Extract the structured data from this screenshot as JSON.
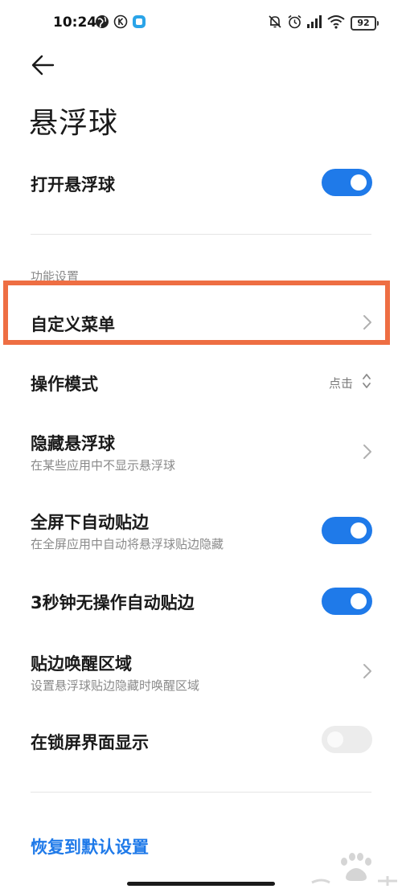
{
  "status_bar": {
    "time": "10:24",
    "battery": "92",
    "icons": [
      "globe-icon",
      "k-badge-icon",
      "app-square-icon",
      "mute-icon",
      "alarm-icon",
      "signal-icon",
      "wifi-icon",
      "battery-icon"
    ]
  },
  "header": {
    "back_icon": "back-arrow-icon",
    "title": "悬浮球"
  },
  "settings": {
    "open_ball": {
      "title": "打开悬浮球",
      "enabled": true
    },
    "section_label": "功能设置",
    "custom_menu": {
      "title": "自定义菜单"
    },
    "operation_mode": {
      "title": "操作模式",
      "value": "点击"
    },
    "hide_ball": {
      "title": "隐藏悬浮球",
      "subtitle": "在某些应用中不显示悬浮球"
    },
    "fullscreen_snap": {
      "title": "全屏下自动贴边",
      "subtitle": "在全屏应用中自动将悬浮球贴边隐藏",
      "enabled": true
    },
    "idle_snap": {
      "title": "3秒钟无操作自动贴边",
      "enabled": true
    },
    "wake_area": {
      "title": "贴边唤醒区域",
      "subtitle": "设置悬浮球贴边隐藏时唤醒区域"
    },
    "lock_screen": {
      "title": "在锁屏界面显示",
      "enabled": false
    },
    "reset_label": "恢复到默认设置"
  },
  "colors": {
    "accent": "#1f7ae9",
    "highlight": "#ee6e43",
    "toggle_off": "#ececec",
    "subtitle": "#8a8a8a"
  },
  "watermark": {
    "icon": "baidu-jingyan-watermark-icon"
  }
}
